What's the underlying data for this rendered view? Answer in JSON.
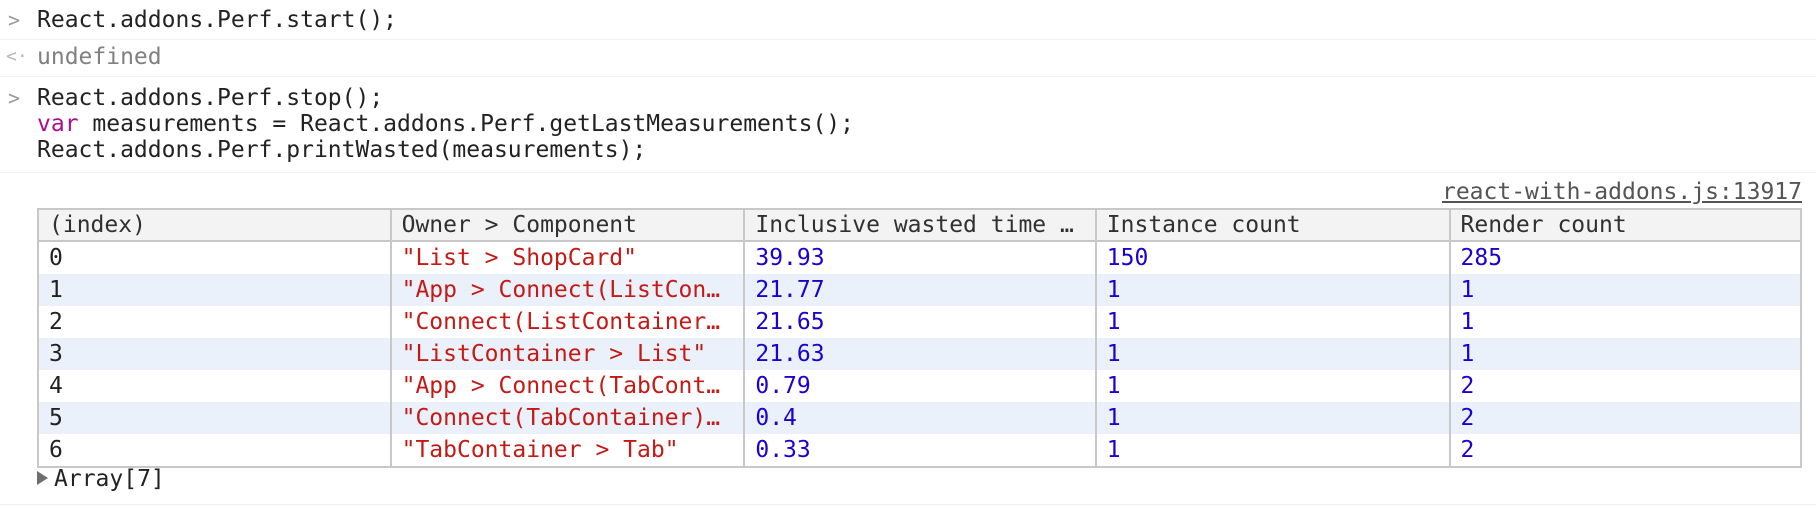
{
  "console": {
    "entry1": {
      "prompt_glyph": ">",
      "code": "React.addons.Perf.start();"
    },
    "entry2": {
      "result_glyph": "<·",
      "value": "undefined"
    },
    "entry3": {
      "prompt_glyph": ">",
      "line1": "React.addons.Perf.stop();",
      "line2_keyword": "var",
      "line2_rest": " measurements = React.addons.Perf.getLastMeasurements();",
      "line3": "React.addons.Perf.printWasted(measurements);"
    },
    "output": {
      "source_link": "react-with-addons.js:13917",
      "table": {
        "headers": [
          "(index)",
          "Owner > Component",
          "Inclusive wasted time …",
          "Instance count",
          "Render count"
        ],
        "rows": [
          {
            "index": "0",
            "component": "\"List > ShopCard\"",
            "time": "39.93",
            "instances": "150",
            "renders": "285"
          },
          {
            "index": "1",
            "component": "\"App > Connect(ListCon…",
            "time": "21.77",
            "instances": "1",
            "renders": "1"
          },
          {
            "index": "2",
            "component": "\"Connect(ListContainer…",
            "time": "21.65",
            "instances": "1",
            "renders": "1"
          },
          {
            "index": "3",
            "component": "\"ListContainer > List\"",
            "time": "21.63",
            "instances": "1",
            "renders": "1"
          },
          {
            "index": "4",
            "component": "\"App > Connect(TabCont…",
            "time": "0.79",
            "instances": "1",
            "renders": "2"
          },
          {
            "index": "5",
            "component": "\"Connect(TabContainer)…",
            "time": "0.4",
            "instances": "1",
            "renders": "2"
          },
          {
            "index": "6",
            "component": "\"TabContainer > Tab\"",
            "time": "0.33",
            "instances": "1",
            "renders": "2"
          }
        ]
      },
      "array_label": "Array[7]"
    }
  },
  "colors": {
    "string": "#c41a16",
    "number": "#1c00cf",
    "keyword": "#aa0d91",
    "zebra_row": "#eaf1fb",
    "header_bg": "#f3f3f3"
  }
}
